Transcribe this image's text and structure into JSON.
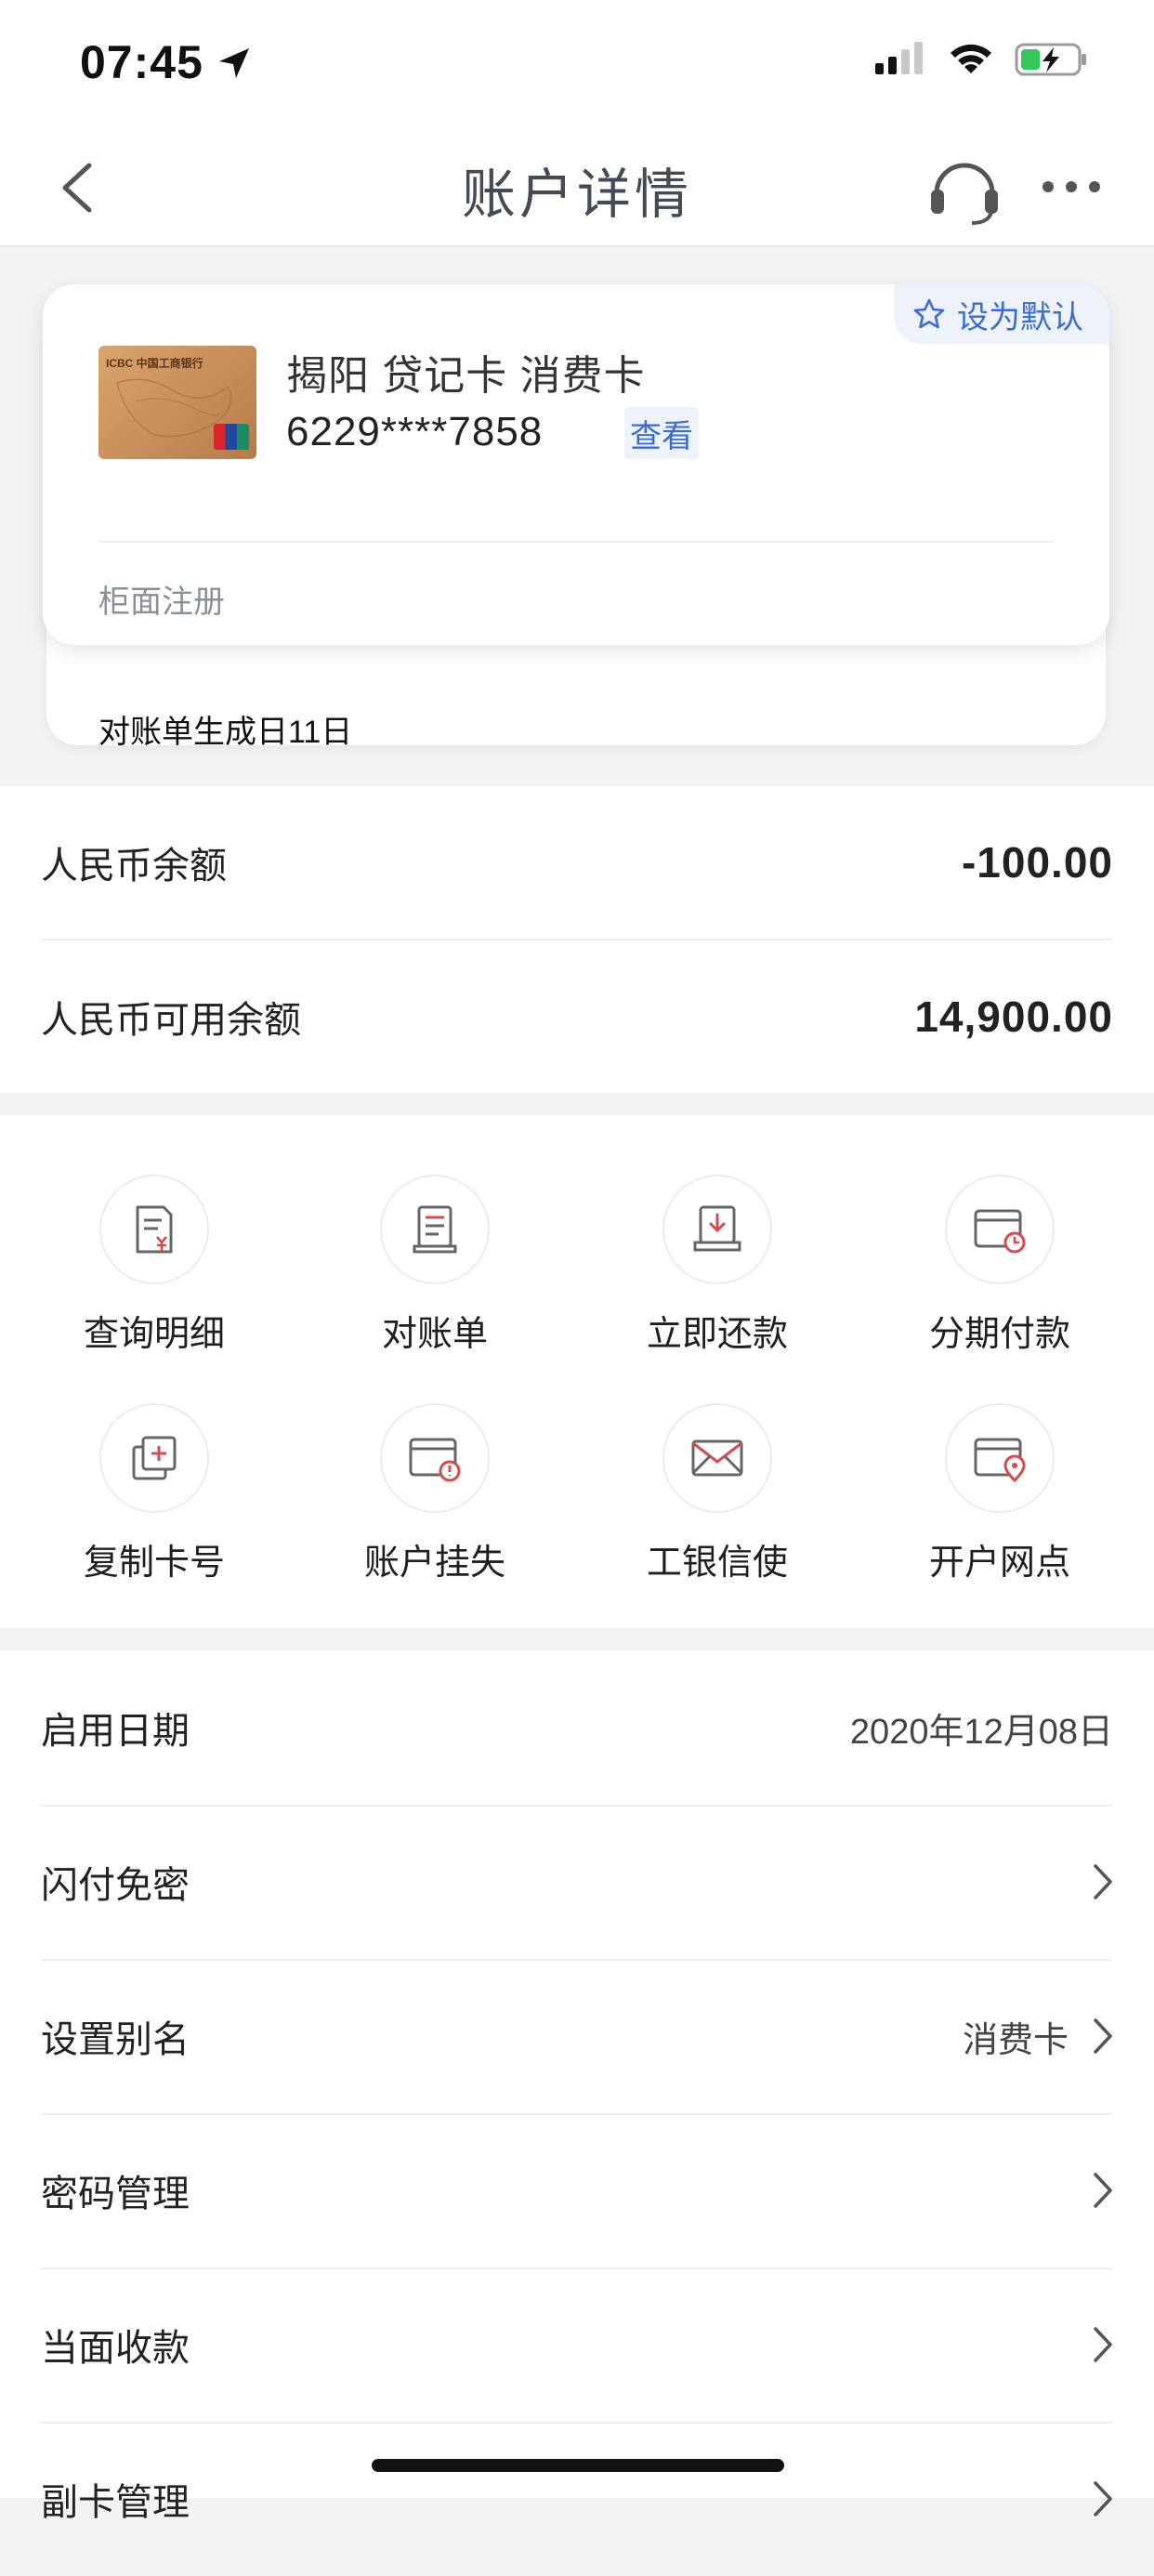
{
  "status_bar": {
    "time": "07:45"
  },
  "nav": {
    "title": "账户详情"
  },
  "card": {
    "default_badge": "设为默认",
    "name": "揭阳 贷记卡  消费卡",
    "number": "6229****7858",
    "view_label": "查看",
    "registration": "柜面注册",
    "statement_day": "对账单生成日11日",
    "bank_logo_text": "ICBC 中国工商银行"
  },
  "balances": [
    {
      "label": "人民币余额",
      "value": "-100.00"
    },
    {
      "label": "人民币可用余额",
      "value": "14,900.00"
    }
  ],
  "functions": [
    {
      "label": "查询明细",
      "icon": "query-details-icon"
    },
    {
      "label": "对账单",
      "icon": "statement-icon"
    },
    {
      "label": "立即还款",
      "icon": "repay-icon"
    },
    {
      "label": "分期付款",
      "icon": "installment-icon"
    },
    {
      "label": "复制卡号",
      "icon": "copy-card-icon"
    },
    {
      "label": "账户挂失",
      "icon": "report-loss-icon"
    },
    {
      "label": "工银信使",
      "icon": "mail-icon"
    },
    {
      "label": "开户网点",
      "icon": "branch-location-icon"
    }
  ],
  "settings": [
    {
      "label": "启用日期",
      "value": "2020年12月08日"
    },
    {
      "label": "闪付免密",
      "value": ""
    },
    {
      "label": "设置别名",
      "value": "消费卡"
    },
    {
      "label": "密码管理",
      "value": ""
    },
    {
      "label": "当面收款",
      "value": ""
    },
    {
      "label": "副卡管理",
      "value": ""
    }
  ],
  "colors": {
    "accent": "#3a6bd6",
    "icon_red": "#d84a4a",
    "background": "#f2f3f5"
  }
}
